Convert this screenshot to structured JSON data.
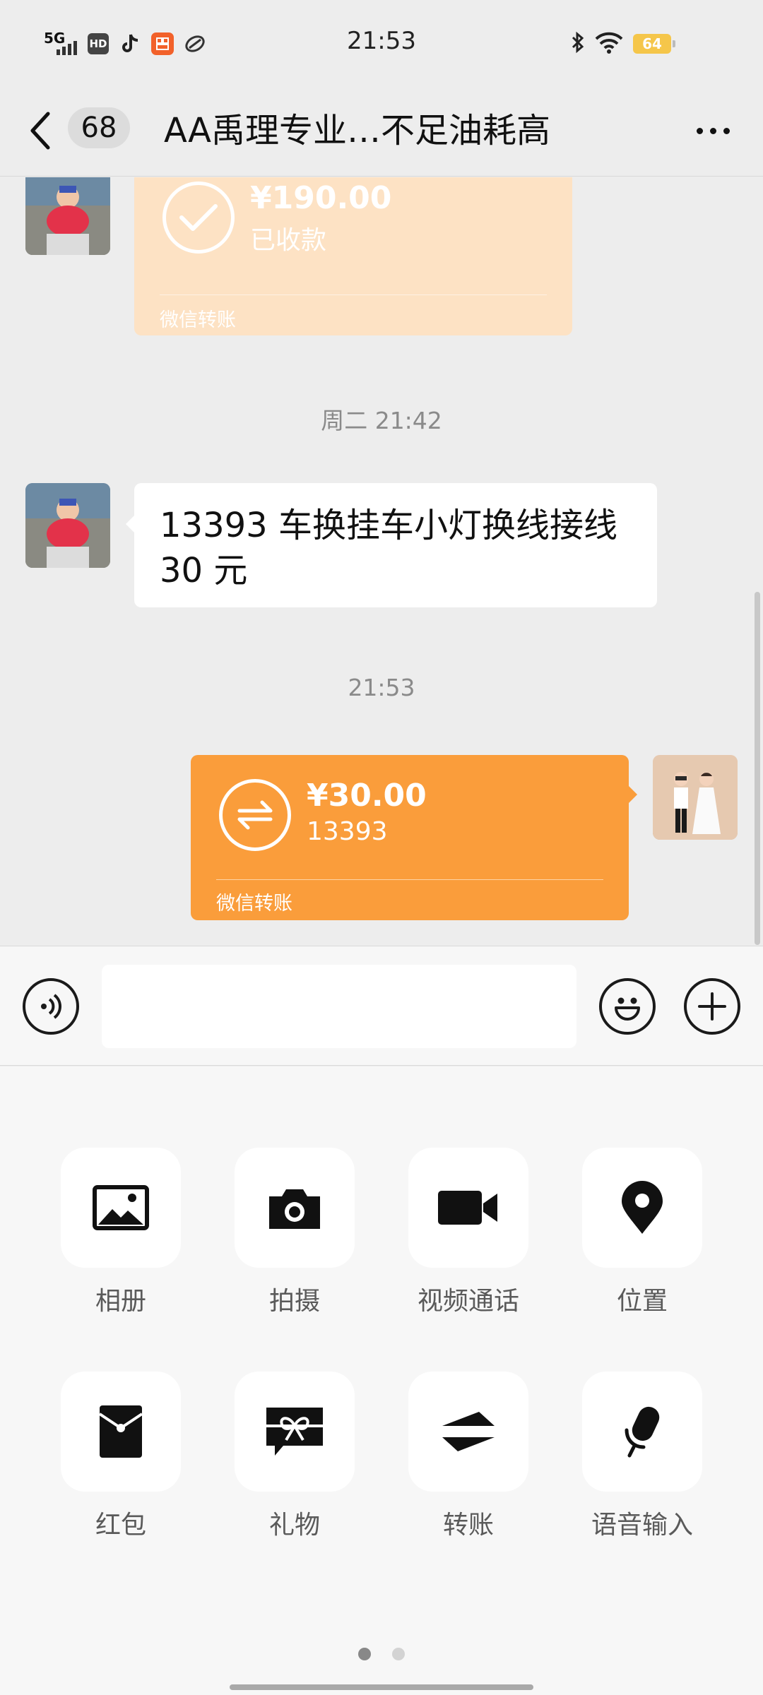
{
  "status_bar": {
    "network": "5G",
    "hd": "HD",
    "time": "21:53",
    "battery": "64"
  },
  "header": {
    "unread_count": "68",
    "title": "AA禹理专业…不足油耗高"
  },
  "messages": {
    "received_transfer": {
      "amount": "¥190.00",
      "status": "已收款",
      "footer": "微信转账"
    },
    "time_1": "周二 21:42",
    "text_message": {
      "line1": "13393 车换挂车小灯换线接线",
      "line2": "30 元"
    },
    "time_2": "21:53",
    "sent_transfer": {
      "amount": "¥30.00",
      "note": "13393",
      "footer": "微信转账"
    }
  },
  "input": {
    "value": "",
    "placeholder": ""
  },
  "panel": {
    "tools": [
      {
        "label": "相册",
        "icon": "album-icon"
      },
      {
        "label": "拍摄",
        "icon": "camera-icon"
      },
      {
        "label": "视频通话",
        "icon": "video-call-icon"
      },
      {
        "label": "位置",
        "icon": "location-icon"
      },
      {
        "label": "红包",
        "icon": "red-packet-icon"
      },
      {
        "label": "礼物",
        "icon": "gift-icon"
      },
      {
        "label": "转账",
        "icon": "transfer-icon"
      },
      {
        "label": "语音输入",
        "icon": "voice-input-icon"
      }
    ],
    "pages": 2,
    "active_page": 1
  },
  "colors": {
    "background": "#ededed",
    "transfer_received": "#fde2c4",
    "transfer_sent": "#fa9d3b",
    "panel": "#f7f7f7"
  }
}
